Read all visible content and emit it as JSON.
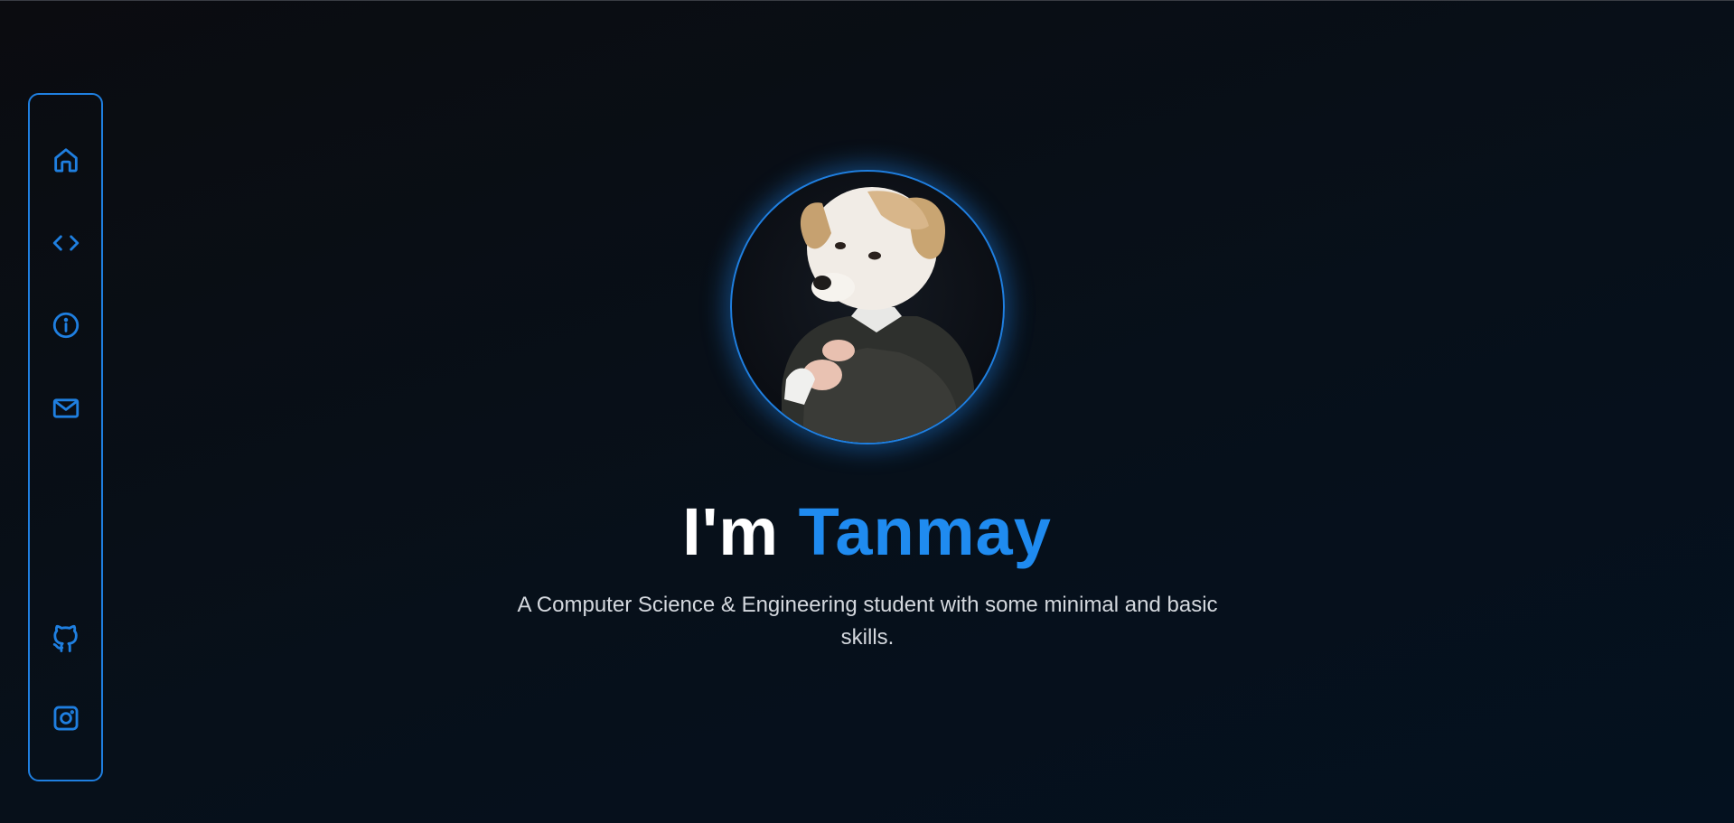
{
  "nav": {
    "items": [
      {
        "icon": "home-icon",
        "label": "Home"
      },
      {
        "icon": "code-icon",
        "label": "Projects"
      },
      {
        "icon": "info-icon",
        "label": "About"
      },
      {
        "icon": "mail-icon",
        "label": "Contact"
      }
    ],
    "social": [
      {
        "icon": "github-icon",
        "label": "GitHub"
      },
      {
        "icon": "instagram-icon",
        "label": "Instagram"
      }
    ]
  },
  "hero": {
    "greeting": "I'm",
    "name": "Tanmay",
    "subtitle": "A Computer Science & Engineering student with some minimal and basic skills."
  },
  "colors": {
    "accent": "#1f7fe0",
    "name_accent": "#1f8bf0",
    "background": "#07101a"
  }
}
